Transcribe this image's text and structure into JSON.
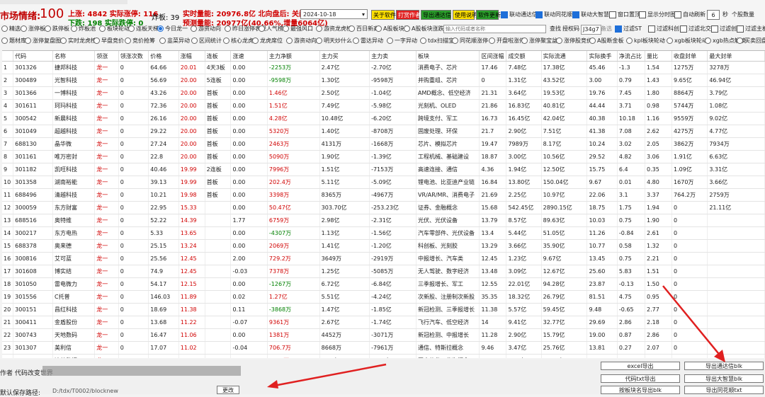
{
  "header": {
    "mood_label": "市场情绪:",
    "mood_value": "100",
    "up_label": "上涨: 4842 实际涨停: 116",
    "down_label": "下跌: 198  实际跌停: 0",
    "blast_label": "炸板: 39",
    "realtime_vol": "实时量能: 20976.8亿 北向盘后: 关闭中",
    "forecast_vol": "预测量能: 20977亿(40.66%,增量6064亿)",
    "date": "2024-10-18",
    "buttons": [
      "关于软件",
      "打赏作者",
      "导出通达信",
      "使用说明",
      "软件更新"
    ],
    "checkboxes": [
      {
        "label": "联动通达信",
        "on": true
      },
      {
        "label": "联动同花顺",
        "on": true
      },
      {
        "label": "联动大智慧",
        "on": true
      },
      {
        "label": "窗口置顶",
        "on": false
      },
      {
        "label": "显示分时图",
        "on": false
      },
      {
        "label": "自动刷新",
        "on": false
      }
    ],
    "refresh_sec": "6",
    "refresh_unit": "秒",
    "count_label": "个股数量"
  },
  "row1": {
    "options": [
      "精选",
      "涨停板",
      "跌停板",
      "炸板池",
      "板块轮动",
      "连板天梯",
      "今日龙一",
      "游资动向",
      "昨日涨停表现",
      "人气榜",
      "最强风口",
      "游资龙虎榜",
      "百日新高",
      "A股板块数",
      "A股板块涨跌"
    ],
    "search_placeholder": "输入代码或者名称",
    "search_btn": "查找",
    "auth_label": "授权码",
    "auth_code": "J34g7",
    "note": "备选",
    "filters": [
      {
        "label": "过滤ST",
        "on": true
      },
      {
        "label": "过滤科创",
        "on": false
      },
      {
        "label": "过滤北交",
        "on": false
      },
      {
        "label": "过滤创业",
        "on": false
      },
      {
        "label": "过滤主板",
        "on": false
      }
    ]
  },
  "row2": {
    "options": [
      "题材库",
      "涨停复盘图",
      "实时龙虎榜",
      "早盘竞价",
      "竞价抢筹",
      "韭菜异动",
      "区间统计",
      "核心龙虎",
      "龙虎席位",
      "游资动向",
      "明天炒什么",
      "雷达异动",
      "一字异动",
      "tdx扫描宝",
      "同花顺涨停",
      "开盘啦涨停",
      "涨停聚宝盆",
      "涨停股竞价",
      "A股断金板",
      "kpl板块轮动",
      "xgb板块轮动",
      "xgb热点解读",
      "买卖回盘"
    ]
  },
  "table": {
    "columns": [
      "代码",
      "名称",
      "领涨",
      "领涨次数",
      "价格",
      "涨幅",
      "连板",
      "涨速",
      "主力净额",
      "主力买",
      "主力卖",
      "板块",
      "区间涨幅",
      "成交额",
      "实际流通",
      "实际换手",
      "净流占比",
      "量比",
      "收盘封单",
      "最大封单"
    ],
    "rows": [
      [
        "301326",
        "捷邦科技",
        "龙一",
        "0",
        "64.66",
        "20.01",
        "4天3板",
        "0.00",
        "-2253万",
        "2.47亿",
        "-2.70亿",
        "消费电子、芯片",
        "17.46",
        "7.48亿",
        "17.38亿",
        "45.46",
        "-1.3",
        "1.54",
        "1275万",
        "3278万"
      ],
      [
        "300489",
        "光智科技",
        "龙一",
        "0",
        "56.69",
        "20.00",
        "5连板",
        "0.00",
        "-9598万",
        "1.30亿",
        "-9598万",
        "并购重组、芯片",
        "0",
        "1.31亿",
        "43.52亿",
        "3.00",
        "0.79",
        "1.43",
        "9.65亿",
        "46.94亿"
      ],
      [
        "301366",
        "一博科技",
        "龙一",
        "0",
        "43.26",
        "20.00",
        "首板",
        "0.00",
        "1.46亿",
        "2.50亿",
        "-1.04亿",
        "AMD概念、低空经济",
        "21.31",
        "3.64亿",
        "19.53亿",
        "19.76",
        "7.45",
        "1.80",
        "8864万",
        "3.79亿"
      ],
      [
        "301611",
        "珂玛科技",
        "龙一",
        "0",
        "72.36",
        "20.00",
        "首板",
        "0.00",
        "1.51亿",
        "7.49亿",
        "-5.98亿",
        "光刻机、OLED",
        "21.86",
        "16.83亿",
        "40.81亿",
        "44.44",
        "3.71",
        "0.98",
        "5744万",
        "1.08亿"
      ],
      [
        "300542",
        "新晨科技",
        "龙一",
        "0",
        "26.16",
        "20.00",
        "首板",
        "0.00",
        "4.28亿",
        "10.48亿",
        "-6.20亿",
        "跨境支付、军工",
        "16.73",
        "16.45亿",
        "42.04亿",
        "40.38",
        "10.18",
        "1.16",
        "9559万",
        "9.02亿"
      ],
      [
        "301049",
        "超越科技",
        "龙一",
        "0",
        "29.22",
        "20.00",
        "首板",
        "0.00",
        "5320万",
        "1.40亿",
        "-8708万",
        "固废处理、环保",
        "21.7",
        "2.90亿",
        "7.51亿",
        "41.38",
        "7.08",
        "2.62",
        "4275万",
        "4.77亿"
      ],
      [
        "688130",
        "晶华微",
        "龙一",
        "0",
        "27.24",
        "20.00",
        "首板",
        "0.00",
        "2463万",
        "4131万",
        "-1668万",
        "芯片、模拟芯片",
        "19.47",
        "7989万",
        "8.17亿",
        "10.24",
        "3.02",
        "2.05",
        "3862万",
        "7934万"
      ],
      [
        "301161",
        "唯万密封",
        "龙一",
        "0",
        "22.8",
        "20.00",
        "首板",
        "0.00",
        "5090万",
        "1.90亿",
        "-1.39亿",
        "工程机械、基础建设",
        "18.87",
        "3.00亿",
        "10.56亿",
        "29.52",
        "4.82",
        "3.06",
        "1.91亿",
        "6.63亿"
      ],
      [
        "301182",
        "凯旺科技",
        "龙一",
        "0",
        "40.46",
        "19.99",
        "2连板",
        "0.00",
        "7996万",
        "1.51亿",
        "-7153万",
        "高速连接、通信",
        "4.36",
        "1.94亿",
        "12.50亿",
        "15.75",
        "6.4",
        "0.35",
        "1.09亿",
        "3.31亿"
      ],
      [
        "301358",
        "湖南裕能",
        "龙一",
        "0",
        "39.13",
        "19.99",
        "首板",
        "0.00",
        "202.4万",
        "5.11亿",
        "-5.09亿",
        "锂电池、比亚迪产业链",
        "16.84",
        "13.80亿",
        "150.04亿",
        "9.67",
        "0.01",
        "4.80",
        "1670万",
        "3.66亿"
      ],
      [
        "688496",
        "清越科技",
        "龙一",
        "0",
        "10.21",
        "19.98",
        "首板",
        "0.00",
        "3398万",
        "8365万",
        "-4967万",
        "VR/AR/MR、消费电子",
        "21.69",
        "2.25亿",
        "10.97亿",
        "22.06",
        "3.1",
        "3.37",
        "764.2万",
        "2759万"
      ],
      [
        "300059",
        "东方财富",
        "龙一",
        "0",
        "22.95",
        "15.33",
        "",
        "0.00",
        "50.47亿",
        "303.70亿",
        "-253.23亿",
        "证券、金融概念",
        "15.68",
        "542.45亿",
        "2890.15亿",
        "18.75",
        "1.75",
        "1.94",
        "0",
        "21.11亿"
      ],
      [
        "688516",
        "奥特维",
        "龙一",
        "0",
        "52.22",
        "14.39",
        "",
        "1.77",
        "6759万",
        "2.98亿",
        "-2.31亿",
        "光伏、光伏设备",
        "13.79",
        "8.57亿",
        "89.63亿",
        "10.03",
        "0.75",
        "1.90",
        "0",
        ""
      ],
      [
        "300217",
        "东方电热",
        "龙一",
        "0",
        "5.33",
        "13.65",
        "",
        "0.00",
        "-4307万",
        "1.13亿",
        "-1.56亿",
        "汽车零部件、光伏设备",
        "13.4",
        "5.44亿",
        "51.05亿",
        "11.26",
        "-0.84",
        "2.61",
        "0",
        ""
      ],
      [
        "688378",
        "奥来德",
        "龙一",
        "0",
        "25.15",
        "13.24",
        "",
        "0.00",
        "2069万",
        "1.41亿",
        "-1.20亿",
        "科创板、光刻胶",
        "13.29",
        "3.66亿",
        "35.90亿",
        "10.77",
        "0.58",
        "1.32",
        "0",
        ""
      ],
      [
        "300816",
        "艾可蓝",
        "龙一",
        "0",
        "25.56",
        "12.45",
        "",
        "2.00",
        "729.2万",
        "3649万",
        "-2919万",
        "中报增长、汽车类",
        "12.45",
        "1.23亿",
        "9.67亿",
        "13.45",
        "0.75",
        "2.21",
        "0",
        ""
      ],
      [
        "301608",
        "博实结",
        "龙一",
        "0",
        "74.9",
        "12.45",
        "",
        "-0.03",
        "7378万",
        "1.25亿",
        "-5085万",
        "无人驾驶、数字经济",
        "13.48",
        "3.09亿",
        "12.67亿",
        "25.60",
        "5.83",
        "1.51",
        "0",
        ""
      ],
      [
        "301050",
        "雷电微力",
        "龙一",
        "0",
        "54.17",
        "12.15",
        "",
        "0.00",
        "-1267万",
        "6.72亿",
        "-6.84亿",
        "三季报增长、军工",
        "12.55",
        "22.01亿",
        "94.28亿",
        "23.87",
        "-0.13",
        "1.50",
        "0",
        ""
      ],
      [
        "301556",
        "C托普",
        "龙一",
        "0",
        "146.03",
        "11.89",
        "",
        "0.02",
        "1.27亿",
        "5.51亿",
        "-4.24亿",
        "次新股、注册制次新股",
        "35.35",
        "18.32亿",
        "26.79亿",
        "81.51",
        "4.75",
        "0.95",
        "0",
        ""
      ],
      [
        "300151",
        "昌红科技",
        "龙一",
        "0",
        "18.69",
        "11.38",
        "",
        "0.11",
        "-3868万",
        "1.47亿",
        "-1.85亿",
        "新冠检测、三季报增长",
        "11.38",
        "5.57亿",
        "59.45亿",
        "9.48",
        "-0.65",
        "2.77",
        "0",
        ""
      ],
      [
        "300411",
        "金盾股份",
        "龙一",
        "0",
        "13.68",
        "11.22",
        "",
        "-0.07",
        "9361万",
        "2.67亿",
        "-1.74亿",
        "飞行汽车、低空经济",
        "14",
        "9.41亿",
        "32.77亿",
        "29.69",
        "2.86",
        "2.18",
        "0",
        ""
      ],
      [
        "300743",
        "天地数码",
        "龙一",
        "0",
        "16.47",
        "11.06",
        "",
        "0.00",
        "1381万",
        "4452万",
        "-3071万",
        "新冠检测、中报增长",
        "11.28",
        "2.90亿",
        "15.79亿",
        "19.00",
        "0.87",
        "2.86",
        "0",
        ""
      ],
      [
        "301307",
        "美利信",
        "龙一",
        "0",
        "17.07",
        "11.02",
        "",
        "-0.04",
        "706.7万",
        "8668万",
        "-7961万",
        "通信、特斯拉概念",
        "9.46",
        "3.47亿",
        "25.76亿",
        "13.81",
        "0.27",
        "2.07",
        "0",
        ""
      ],
      [
        "688692",
        "达梦数据",
        "龙一",
        "0",
        "343.02",
        "10.79",
        "",
        "0.01",
        "1447万",
        "1.76亿",
        "-1.61亿",
        "国产软件、华为概念",
        "12",
        "4.48亿",
        "49.00亿",
        "9.46",
        "0.3",
        "1.51",
        "0",
        ""
      ]
    ]
  },
  "footer": {
    "author": "作者 代码改变世界",
    "path_label": "默认保存路径:",
    "path_value": "D:/tdx/T0002/blocknew",
    "change_btn": "更改",
    "export_buttons": [
      "excel导出",
      "导出通达信blk",
      "代码txt导出",
      "导出大智慧blk",
      "按板块名导出blk",
      "导出同花顺txt"
    ]
  }
}
